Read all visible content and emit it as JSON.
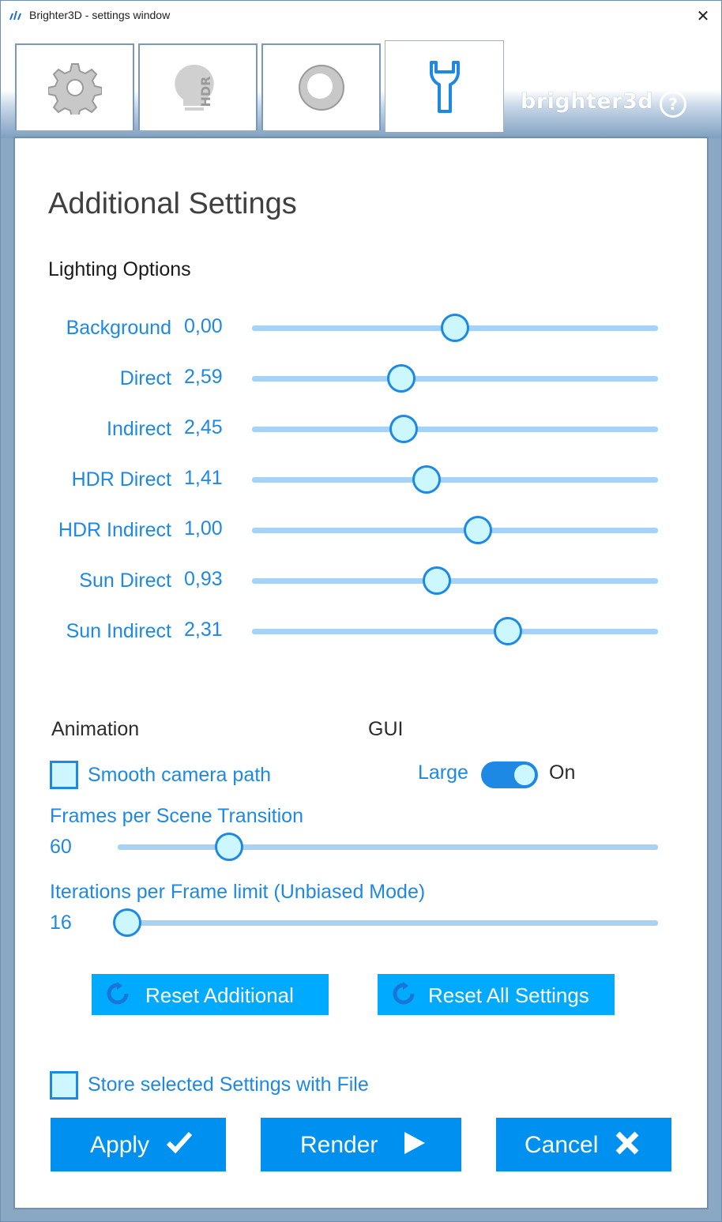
{
  "window": {
    "title": "Brighter3D - settings window",
    "close_glyph": "✕"
  },
  "tabs": [
    {
      "name": "general",
      "icon": "gear-icon",
      "active": false
    },
    {
      "name": "hdr",
      "icon": "hdr-bulb-icon",
      "active": false
    },
    {
      "name": "material",
      "icon": "sphere-icon",
      "active": false
    },
    {
      "name": "additional",
      "icon": "wrench-icon",
      "active": true
    }
  ],
  "brand": {
    "text": "brighter3d",
    "help_glyph": "?"
  },
  "main": {
    "heading": "Additional Settings",
    "lighting_title": "Lighting Options",
    "lighting": [
      {
        "label": "Background",
        "value": "0,00",
        "fraction": 0.5
      },
      {
        "label": "Direct",
        "value": "2,59",
        "fraction": 0.367
      },
      {
        "label": "Indirect",
        "value": "2,45",
        "fraction": 0.373
      },
      {
        "label": "HDR Direct",
        "value": "1,41",
        "fraction": 0.43
      },
      {
        "label": "HDR Indirect",
        "value": "1,00",
        "fraction": 0.557
      },
      {
        "label": "Sun Direct",
        "value": "0,93",
        "fraction": 0.455
      },
      {
        "label": "Sun Indirect",
        "value": "2,31",
        "fraction": 0.63
      }
    ],
    "animation_title": "Animation",
    "gui_title": "GUI",
    "smooth_camera_label": "Smooth camera path",
    "smooth_camera_checked": false,
    "gui_size_label": "Large",
    "gui_toggle_state": "On",
    "frames_label": "Frames per Scene Transition",
    "frames_value": "60",
    "frames_fraction": 0.18,
    "iterations_label": "Iterations per Frame limit (Unbiased Mode)",
    "iterations_value": "16",
    "iterations_fraction": 0.0,
    "reset_additional_label": "Reset Additional",
    "reset_all_label": "Reset All Settings",
    "store_label": "Store selected Settings with File",
    "store_checked": false
  },
  "actions": {
    "apply_label": "Apply",
    "render_label": "Render",
    "cancel_label": "Cancel"
  },
  "colors": {
    "accent": "#1e88e5",
    "button_blue": "#0090f0",
    "reset_blue": "#00aaff",
    "thumb_fill": "#ccf7ff",
    "track": "#a8d2f5"
  }
}
